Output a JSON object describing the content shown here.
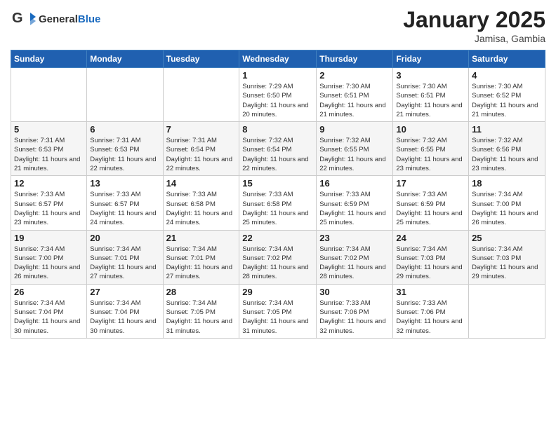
{
  "header": {
    "logo_general": "General",
    "logo_blue": "Blue",
    "month_title": "January 2025",
    "location": "Jamisa, Gambia"
  },
  "days_of_week": [
    "Sunday",
    "Monday",
    "Tuesday",
    "Wednesday",
    "Thursday",
    "Friday",
    "Saturday"
  ],
  "weeks": [
    [
      {
        "day": "",
        "info": ""
      },
      {
        "day": "",
        "info": ""
      },
      {
        "day": "",
        "info": ""
      },
      {
        "day": "1",
        "info": "Sunrise: 7:29 AM\nSunset: 6:50 PM\nDaylight: 11 hours and 20 minutes."
      },
      {
        "day": "2",
        "info": "Sunrise: 7:30 AM\nSunset: 6:51 PM\nDaylight: 11 hours and 21 minutes."
      },
      {
        "day": "3",
        "info": "Sunrise: 7:30 AM\nSunset: 6:51 PM\nDaylight: 11 hours and 21 minutes."
      },
      {
        "day": "4",
        "info": "Sunrise: 7:30 AM\nSunset: 6:52 PM\nDaylight: 11 hours and 21 minutes."
      }
    ],
    [
      {
        "day": "5",
        "info": "Sunrise: 7:31 AM\nSunset: 6:53 PM\nDaylight: 11 hours and 21 minutes."
      },
      {
        "day": "6",
        "info": "Sunrise: 7:31 AM\nSunset: 6:53 PM\nDaylight: 11 hours and 22 minutes."
      },
      {
        "day": "7",
        "info": "Sunrise: 7:31 AM\nSunset: 6:54 PM\nDaylight: 11 hours and 22 minutes."
      },
      {
        "day": "8",
        "info": "Sunrise: 7:32 AM\nSunset: 6:54 PM\nDaylight: 11 hours and 22 minutes."
      },
      {
        "day": "9",
        "info": "Sunrise: 7:32 AM\nSunset: 6:55 PM\nDaylight: 11 hours and 22 minutes."
      },
      {
        "day": "10",
        "info": "Sunrise: 7:32 AM\nSunset: 6:55 PM\nDaylight: 11 hours and 23 minutes."
      },
      {
        "day": "11",
        "info": "Sunrise: 7:32 AM\nSunset: 6:56 PM\nDaylight: 11 hours and 23 minutes."
      }
    ],
    [
      {
        "day": "12",
        "info": "Sunrise: 7:33 AM\nSunset: 6:57 PM\nDaylight: 11 hours and 23 minutes."
      },
      {
        "day": "13",
        "info": "Sunrise: 7:33 AM\nSunset: 6:57 PM\nDaylight: 11 hours and 24 minutes."
      },
      {
        "day": "14",
        "info": "Sunrise: 7:33 AM\nSunset: 6:58 PM\nDaylight: 11 hours and 24 minutes."
      },
      {
        "day": "15",
        "info": "Sunrise: 7:33 AM\nSunset: 6:58 PM\nDaylight: 11 hours and 25 minutes."
      },
      {
        "day": "16",
        "info": "Sunrise: 7:33 AM\nSunset: 6:59 PM\nDaylight: 11 hours and 25 minutes."
      },
      {
        "day": "17",
        "info": "Sunrise: 7:33 AM\nSunset: 6:59 PM\nDaylight: 11 hours and 25 minutes."
      },
      {
        "day": "18",
        "info": "Sunrise: 7:34 AM\nSunset: 7:00 PM\nDaylight: 11 hours and 26 minutes."
      }
    ],
    [
      {
        "day": "19",
        "info": "Sunrise: 7:34 AM\nSunset: 7:00 PM\nDaylight: 11 hours and 26 minutes."
      },
      {
        "day": "20",
        "info": "Sunrise: 7:34 AM\nSunset: 7:01 PM\nDaylight: 11 hours and 27 minutes."
      },
      {
        "day": "21",
        "info": "Sunrise: 7:34 AM\nSunset: 7:01 PM\nDaylight: 11 hours and 27 minutes."
      },
      {
        "day": "22",
        "info": "Sunrise: 7:34 AM\nSunset: 7:02 PM\nDaylight: 11 hours and 28 minutes."
      },
      {
        "day": "23",
        "info": "Sunrise: 7:34 AM\nSunset: 7:02 PM\nDaylight: 11 hours and 28 minutes."
      },
      {
        "day": "24",
        "info": "Sunrise: 7:34 AM\nSunset: 7:03 PM\nDaylight: 11 hours and 29 minutes."
      },
      {
        "day": "25",
        "info": "Sunrise: 7:34 AM\nSunset: 7:03 PM\nDaylight: 11 hours and 29 minutes."
      }
    ],
    [
      {
        "day": "26",
        "info": "Sunrise: 7:34 AM\nSunset: 7:04 PM\nDaylight: 11 hours and 30 minutes."
      },
      {
        "day": "27",
        "info": "Sunrise: 7:34 AM\nSunset: 7:04 PM\nDaylight: 11 hours and 30 minutes."
      },
      {
        "day": "28",
        "info": "Sunrise: 7:34 AM\nSunset: 7:05 PM\nDaylight: 11 hours and 31 minutes."
      },
      {
        "day": "29",
        "info": "Sunrise: 7:34 AM\nSunset: 7:05 PM\nDaylight: 11 hours and 31 minutes."
      },
      {
        "day": "30",
        "info": "Sunrise: 7:33 AM\nSunset: 7:06 PM\nDaylight: 11 hours and 32 minutes."
      },
      {
        "day": "31",
        "info": "Sunrise: 7:33 AM\nSunset: 7:06 PM\nDaylight: 11 hours and 32 minutes."
      },
      {
        "day": "",
        "info": ""
      }
    ]
  ]
}
